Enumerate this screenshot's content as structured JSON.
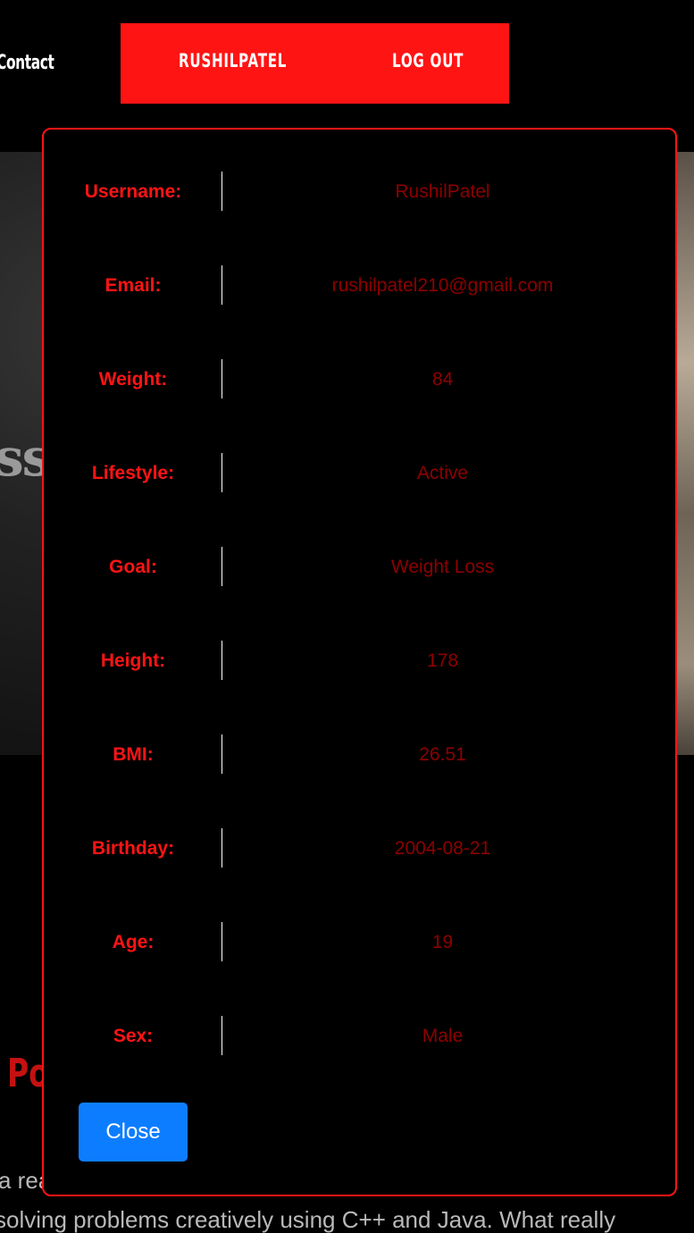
{
  "nav": {
    "contact_label": "Contact",
    "username_link": "RUSHILPATEL",
    "logout_link": "LOG OUT"
  },
  "background": {
    "hero_text": "ss",
    "heading_fragment": "Po",
    "paragraph_line_1": "a rea",
    "paragraph_line_2": "solving problems creatively using C++ and Java. What really"
  },
  "profile": {
    "rows": [
      {
        "label": "Username:",
        "value": "RushilPatel"
      },
      {
        "label": "Email:",
        "value": "rushilpatel210@gmail.com"
      },
      {
        "label": "Weight:",
        "value": "84"
      },
      {
        "label": "Lifestyle:",
        "value": "Active"
      },
      {
        "label": "Goal:",
        "value": "Weight Loss"
      },
      {
        "label": "Height:",
        "value": "178"
      },
      {
        "label": "BMI:",
        "value": "26.51"
      },
      {
        "label": "Birthday:",
        "value": "2004-08-21"
      },
      {
        "label": "Age:",
        "value": "19"
      },
      {
        "label": "Sex:",
        "value": "Male"
      }
    ],
    "close_label": "Close"
  },
  "colors": {
    "accent_red": "#ff1414",
    "value_red": "#8e0000",
    "button_blue": "#0d7dff"
  }
}
